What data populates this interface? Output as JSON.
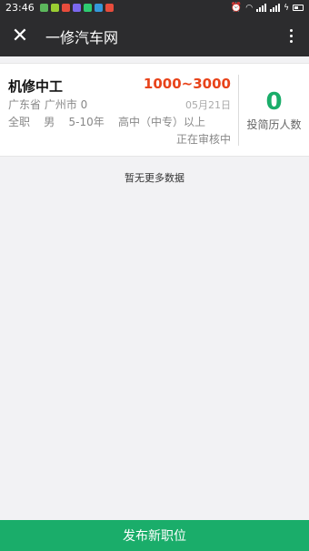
{
  "status_bar": {
    "time": "23:46",
    "notification_icons": [
      {
        "name": "app-notif-icon",
        "color": "#5cb85c"
      },
      {
        "name": "app-notif-icon",
        "color": "#9acd32"
      },
      {
        "name": "app-notif-icon",
        "color": "#e74c3c"
      },
      {
        "name": "app-notif-icon",
        "color": "#7b68ee"
      },
      {
        "name": "wechat-icon",
        "color": "#2ecc71"
      },
      {
        "name": "app-notif-icon",
        "color": "#3498db"
      },
      {
        "name": "app-notif-icon",
        "color": "#e74c3c"
      }
    ]
  },
  "app_bar": {
    "title": "一修汽车网",
    "close_glyph": "✕"
  },
  "job": {
    "title": "机修中工",
    "salary": "1000~3000",
    "location": "广东省 广州市  0",
    "date": "05月21日",
    "requirements": "全职    男    5-10年    高中（中专）以上",
    "status": "正在审核中",
    "applicant_count": "0",
    "applicant_label": "投简历人数"
  },
  "list": {
    "no_more_text": "暂无更多数据"
  },
  "footer": {
    "post_button": "发布新职位"
  },
  "colors": {
    "accent_green": "#1aad6a",
    "salary_red": "#e8431a",
    "bar_dark": "#2c2c2e"
  }
}
